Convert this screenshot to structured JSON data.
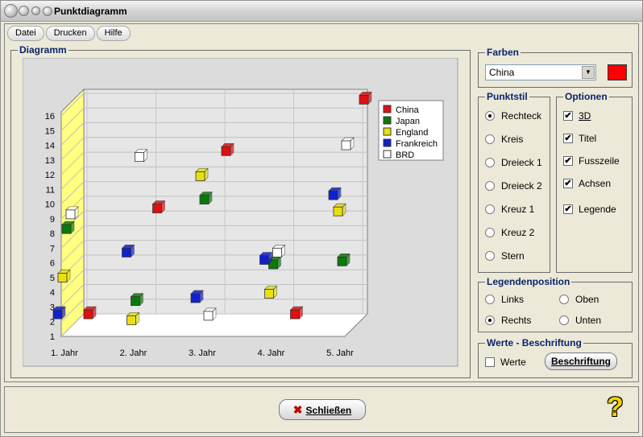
{
  "window": {
    "title": "Punktdiagramm"
  },
  "menu": {
    "items": [
      "Datei",
      "Drucken",
      "Hilfe"
    ]
  },
  "diagram": {
    "group_title": "Diagramm"
  },
  "chart_data": {
    "type": "scatter",
    "categories": [
      "1. Jahr",
      "2. Jahr",
      "3. Jahr",
      "4. Jahr",
      "5. Jahr"
    ],
    "yticks": [
      1,
      2,
      3,
      4,
      5,
      6,
      7,
      8,
      9,
      10,
      11,
      12,
      13,
      14,
      15,
      16
    ],
    "ylim": [
      1,
      16
    ],
    "series": [
      {
        "name": "China",
        "color": "#e01010",
        "values": [
          2.2,
          9.4,
          13.3,
          2.2,
          16.8
        ]
      },
      {
        "name": "Japan",
        "color": "#0a7a0a",
        "values": [
          8.0,
          3.1,
          10.0,
          5.6,
          5.8
        ]
      },
      {
        "name": "England",
        "color": "#e8e010",
        "values": [
          4.7,
          1.8,
          11.6,
          3.6,
          9.2
        ]
      },
      {
        "name": "Frankreich",
        "color": "#1020d0",
        "values": [
          2.2,
          6.4,
          3.3,
          5.9,
          10.3
        ]
      },
      {
        "name": "BRD",
        "color": "#ffffff",
        "values": [
          9.0,
          12.9,
          2.1,
          6.4,
          13.7
        ]
      }
    ]
  },
  "farben": {
    "title": "Farben",
    "selected": "China",
    "color": "#ff0000"
  },
  "punktstil": {
    "title": "Punktstil",
    "options": [
      "Rechteck",
      "Kreis",
      "Dreieck  1",
      "Dreieck 2",
      "Kreuz 1",
      "Kreuz 2",
      "Stern"
    ],
    "selected": 0
  },
  "optionen": {
    "title": "Optionen",
    "options": [
      "3D",
      "Titel",
      "Fusszeile",
      "Achsen",
      "Legende"
    ]
  },
  "legendenposition": {
    "title": "Legendenposition",
    "options": [
      "Links",
      "Oben",
      "Rechts",
      "Unten"
    ],
    "selected": 2
  },
  "werte": {
    "title": "Werte - Beschriftung",
    "checkbox_label": "Werte",
    "button_label": "Beschriftung"
  },
  "footer": {
    "close_label": "Schließen",
    "help_symbol": "?"
  }
}
